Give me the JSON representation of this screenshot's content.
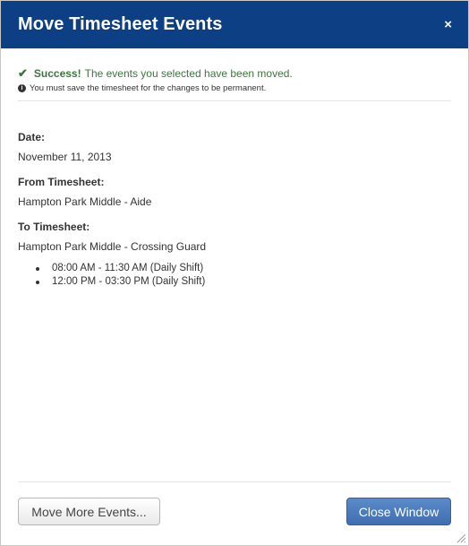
{
  "dialog": {
    "title": "Move Timesheet Events",
    "close_glyph": "×"
  },
  "alert": {
    "success_label": "Success!",
    "success_text": "The events you selected have been moved.",
    "note_text": "You must save the timesheet for the changes to be permanent."
  },
  "details": {
    "date_label": "Date:",
    "date_value": "November 11, 2013",
    "from_label": "From Timesheet:",
    "from_value": "Hampton Park Middle - Aide",
    "to_label": "To Timesheet:",
    "to_value": "Hampton Park Middle - Crossing Guard",
    "events": [
      "08:00 AM - 11:30 AM (Daily Shift)",
      "12:00 PM - 03:30 PM (Daily Shift)"
    ]
  },
  "footer": {
    "move_more_label": "Move More Events...",
    "close_label": "Close Window"
  },
  "icons": {
    "check": "check-icon",
    "info": "info-circle-icon",
    "close": "close-icon",
    "grip": "resize-grip-icon"
  },
  "colors": {
    "titlebar": "#0d3f85",
    "success": "#3c763d",
    "primary_button": "#4a7bbd"
  }
}
